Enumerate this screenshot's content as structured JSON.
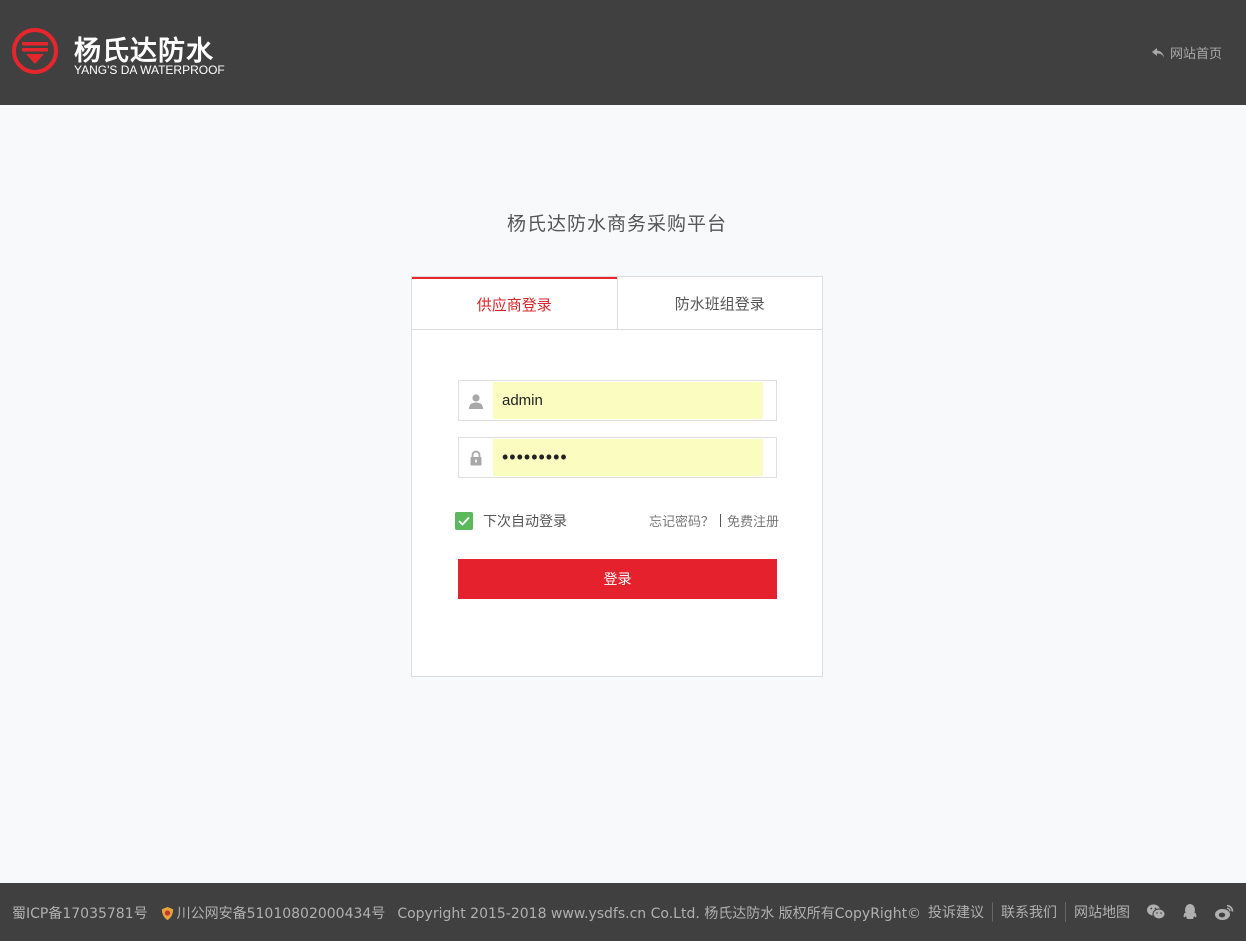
{
  "header": {
    "brand_cn": "杨氏达防水",
    "brand_en": "YANG'S DA WATERPROOF",
    "home_link": "网站首页",
    "brand_color": "#e5262d"
  },
  "main": {
    "title": "杨氏达防水商务采购平台",
    "tabs": [
      {
        "label": "供应商登录",
        "active": true
      },
      {
        "label": "防水班组登录",
        "active": false
      }
    ],
    "username": {
      "value": "admin",
      "icon": "user-icon"
    },
    "password": {
      "value": "•••••••••",
      "icon": "lock-icon"
    },
    "remember_label": "下次自动登录",
    "remember_checked": true,
    "forgot_link": "忘记密码？",
    "register_link": "免费注册",
    "login_button": "登录"
  },
  "footer": {
    "icp": "蜀ICP备17035781号",
    "police": "川公网安备51010802000434号",
    "copyright": "Copyright 2015-2018 www.ysdfs.cn Co.Ltd. 杨氏达防水 版权所有CopyRight©",
    "links": [
      "投诉建议",
      "联系我们",
      "网站地图"
    ],
    "social": [
      "wechat-icon",
      "qq-icon",
      "weibo-icon"
    ]
  }
}
